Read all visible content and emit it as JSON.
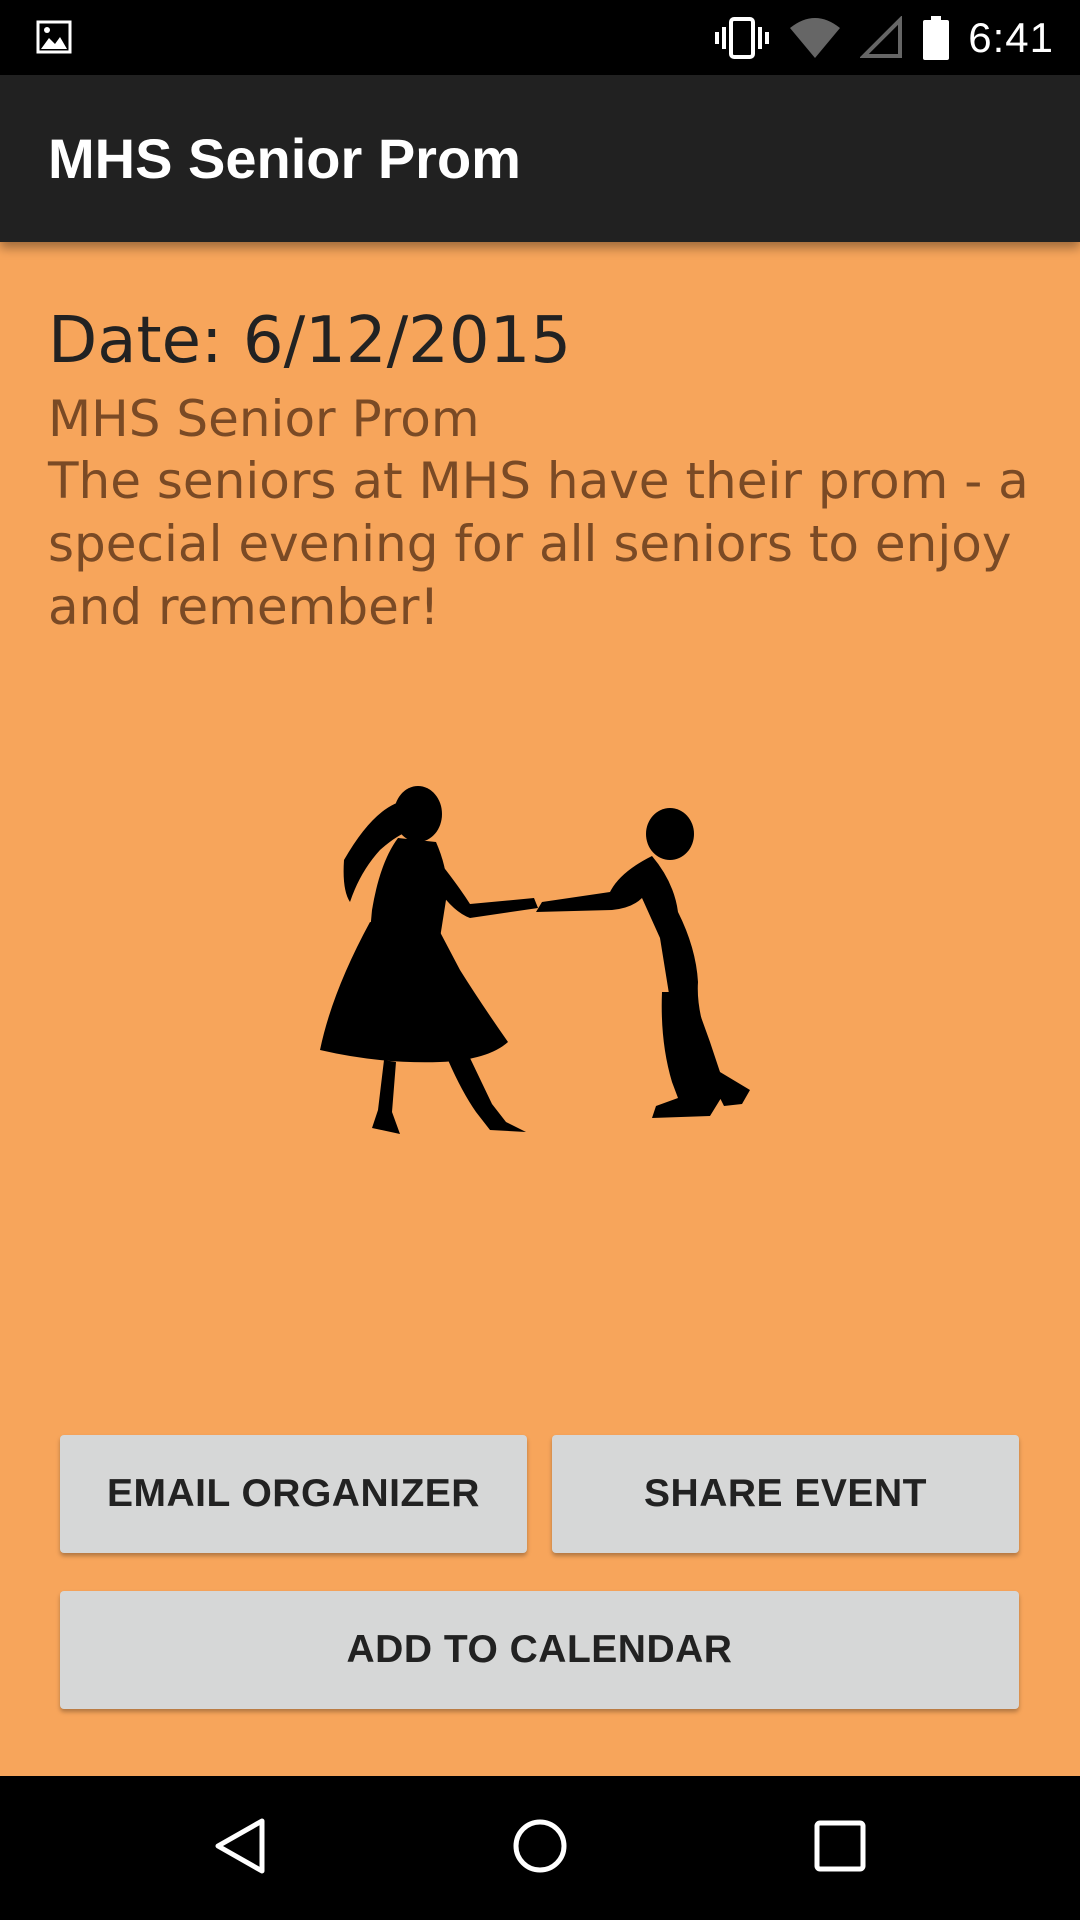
{
  "status_bar": {
    "time": "6:41",
    "icons": [
      "image-notification-icon",
      "vibrate-icon",
      "wifi-icon",
      "signal-icon",
      "battery-icon"
    ]
  },
  "toolbar": {
    "title": "MHS Senior Prom"
  },
  "event": {
    "date_line": "Date: 6/12/2015",
    "title": "MHS Senior Prom",
    "description": "The seniors at MHS have their prom - a special evening for all seniors to enjoy and remember!",
    "image_icon": "dancing-couple-silhouette"
  },
  "actions": {
    "email_label": "EMAIL ORGANIZER",
    "share_label": "SHARE EVENT",
    "calendar_label": "ADD TO CALENDAR"
  },
  "nav": {
    "icons": [
      "back-icon",
      "home-icon",
      "recents-icon"
    ]
  },
  "colors": {
    "background": "#f7a55b",
    "toolbar": "#212121",
    "button": "#d6d7d7",
    "secondary_text": "#7a4a25"
  }
}
